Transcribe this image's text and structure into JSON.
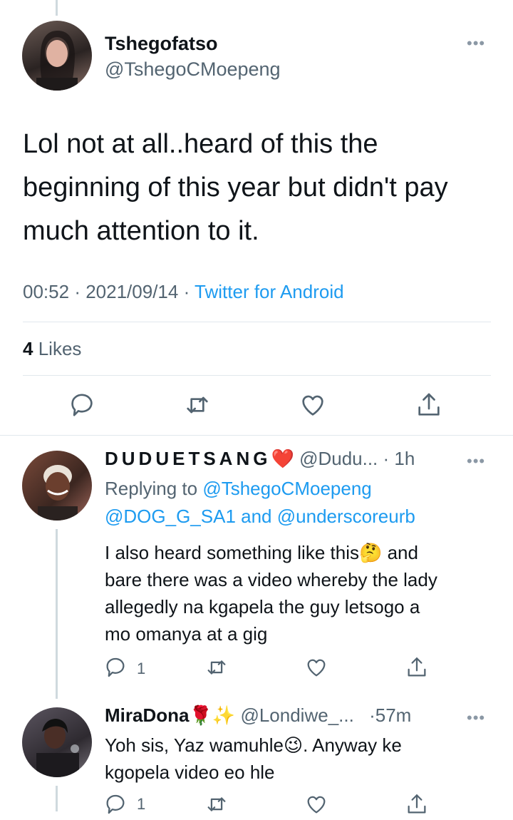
{
  "main_tweet": {
    "display_name": "Tshegofatso",
    "handle": "@TshegoCMoepeng",
    "text_lines": [
      "Lol not at all..heard of this the",
      "beginning of this year but didn't pay",
      "much attention to it."
    ],
    "time": "00:52",
    "date": "2021/09/14",
    "source": "Twitter for Android",
    "separator": "·",
    "likes_count": "4",
    "likes_label": "Likes"
  },
  "reply1": {
    "display_name": "DUDUETSANG",
    "emoji": "❤️",
    "handle": "@Dudu...",
    "age": "· 1h",
    "replying_prefix": "Replying to",
    "replying_to_1": "@TshegoCMoepeng",
    "replying_to_2": "@DOG_G_SA1",
    "replying_and": "and",
    "replying_to_3": "@underscoreurb",
    "text_line1_a": "I also heard something like this",
    "text_line1_emoji": "🤔",
    "text_line1_b": " and",
    "text_line2": "bare there was a video whereby the lady",
    "text_line3": "allegedly na kgapela the guy letsogo a",
    "text_line4": "mo omanya at a gig",
    "reply_count": "1"
  },
  "reply2": {
    "display_name": "MiraDona",
    "emoji": "🌹✨",
    "handle": "@Londiwe_...",
    "age": "·57m",
    "text_line1_a": "Yoh sis, Yaz wamuhle",
    "text_line1_emoji": "😉",
    "text_line1_b": ". Anyway ke",
    "text_line2": "kgopela video eo hle",
    "reply_count": "1"
  },
  "colors": {
    "accent": "#1d9bf0",
    "muted": "#536471",
    "icon": "#536471",
    "heart": "#e0245e"
  }
}
